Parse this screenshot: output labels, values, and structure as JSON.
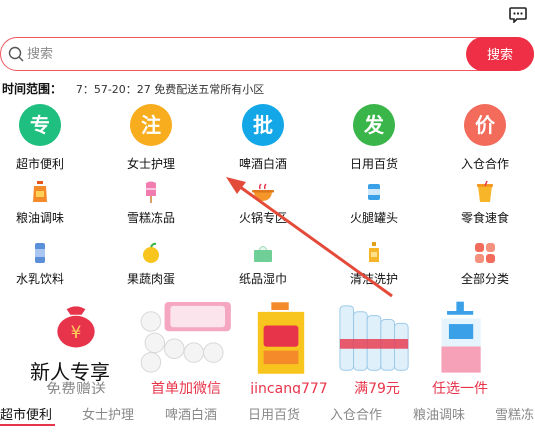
{
  "header": {
    "message_icon": "chat-bubble-icon"
  },
  "search": {
    "placeholder": "搜索",
    "button_label": "搜索"
  },
  "delivery": {
    "label": "时间范围：",
    "value": "7：57-20：27 免费配送五常所有小区"
  },
  "featured": [
    {
      "glyph": "专",
      "label": "超市便利",
      "color": "#1fbf7f"
    },
    {
      "glyph": "注",
      "label": "女士护理",
      "color": "#f7ad1e"
    },
    {
      "glyph": "批",
      "label": "啤酒白酒",
      "color": "#13a7e8"
    },
    {
      "glyph": "发",
      "label": "日用百货",
      "color": "#3ab54a"
    },
    {
      "glyph": "价",
      "label": "入仓合作",
      "color": "#f26b5b"
    }
  ],
  "categories_row2": [
    {
      "icon": "oil-bottle-icon",
      "label": "粮油调味"
    },
    {
      "icon": "popsicle-icon",
      "label": "雪糕冻品"
    },
    {
      "icon": "hotpot-icon",
      "label": "火锅专区"
    },
    {
      "icon": "can-icon",
      "label": "火腿罐头"
    },
    {
      "icon": "snack-cup-icon",
      "label": "零食速食"
    }
  ],
  "categories_row3": [
    {
      "icon": "drink-can-icon",
      "label": "水乳饮料"
    },
    {
      "icon": "apple-icon",
      "label": "果蔬肉蛋"
    },
    {
      "icon": "tissue-box-icon",
      "label": "纸品湿巾"
    },
    {
      "icon": "soap-bottle-icon",
      "label": "清洁洗护"
    },
    {
      "icon": "all-categories-icon",
      "label": "全部分类"
    }
  ],
  "promos": {
    "new_user": {
      "title": "新人专享",
      "subtitle": "免费赠送"
    },
    "items": [
      {
        "text": "首单加微信"
      },
      {
        "text": "jincang777"
      },
      {
        "text": "满79元"
      },
      {
        "text": "任选一件"
      }
    ]
  },
  "tabs": [
    "超市便利",
    "女士护理",
    "啤酒白酒",
    "日用百货",
    "入仓合作",
    "粮油调味",
    "雪糕冻"
  ],
  "colors": {
    "accent": "#ee2f45",
    "search_border": "#f0565f"
  }
}
